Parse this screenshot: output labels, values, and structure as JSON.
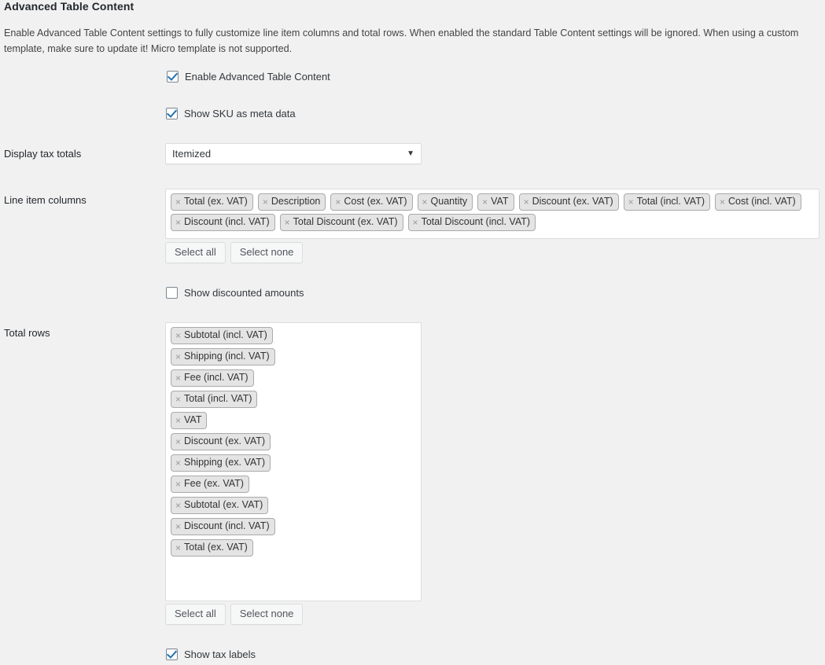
{
  "section": {
    "title": "Advanced Table Content",
    "description": "Enable Advanced Table Content settings to fully customize line item columns and total rows. When enabled the standard Table Content settings will be ignored. When using a custom template, make sure to update it! Micro template is not supported."
  },
  "enable_advanced": {
    "label": "Enable Advanced Table Content",
    "checked": true
  },
  "show_sku": {
    "label": "Show SKU as meta data",
    "checked": true
  },
  "display_tax_totals": {
    "label": "Display tax totals",
    "value": "Itemized",
    "arrow": "▼"
  },
  "line_item_columns": {
    "label": "Line item columns",
    "remove_icon": "×",
    "tags": [
      "Total (ex. VAT)",
      "Description",
      "Cost (ex. VAT)",
      "Quantity",
      "VAT",
      "Discount (ex. VAT)",
      "Total (incl. VAT)",
      "Cost (incl. VAT)",
      "Discount (incl. VAT)",
      "Total Discount (ex. VAT)",
      "Total Discount (incl. VAT)"
    ],
    "select_all_label": "Select all",
    "select_none_label": "Select none"
  },
  "show_discounted_amounts": {
    "label": "Show discounted amounts",
    "checked": false
  },
  "total_rows": {
    "label": "Total rows",
    "remove_icon": "×",
    "tags": [
      "Subtotal (incl. VAT)",
      "Shipping (incl. VAT)",
      "Fee (incl. VAT)",
      "Total (incl. VAT)",
      "VAT",
      "Discount (ex. VAT)",
      "Shipping (ex. VAT)",
      "Fee (ex. VAT)",
      "Subtotal (ex. VAT)",
      "Discount (incl. VAT)",
      "Total (ex. VAT)"
    ],
    "select_all_label": "Select all",
    "select_none_label": "Select none"
  },
  "show_tax_labels": {
    "label": "Show tax labels",
    "checked": true
  },
  "colors": {
    "page_background": "#f1f1f1",
    "checkbox_accent": "#2271b1",
    "tag_background": "#e4e4e4",
    "tag_border": "#aaaaaa",
    "field_border": "#dddddd"
  }
}
